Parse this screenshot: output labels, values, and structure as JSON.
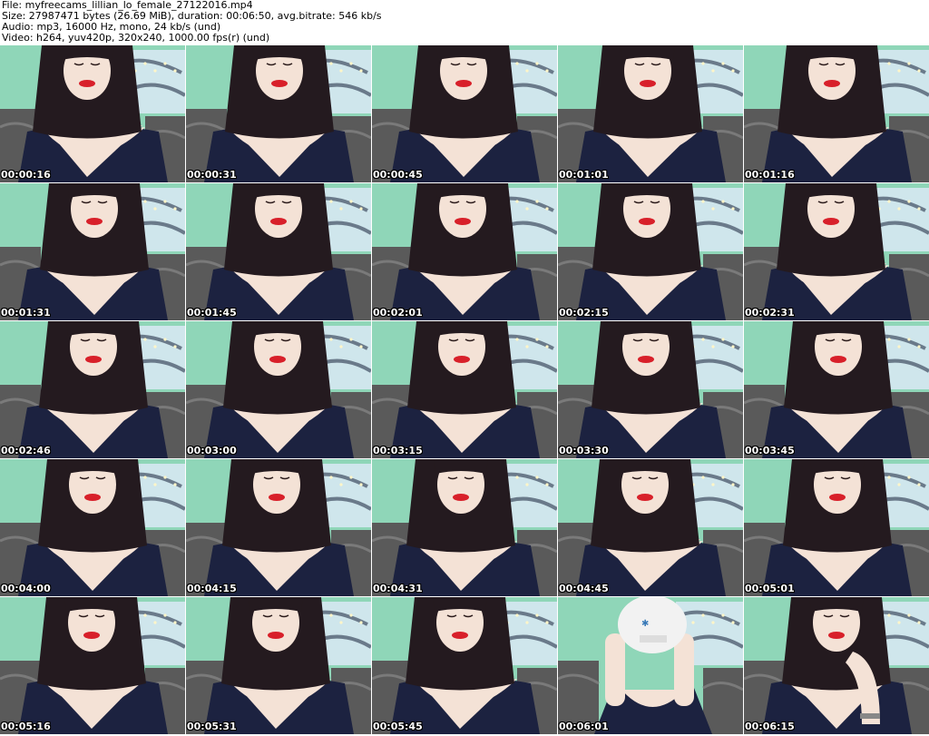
{
  "header": {
    "file_line": "File: myfreecams_lillian_lo_female_27122016.mp4",
    "size_line": "Size: 27987471 bytes (26.69 MiB), duration: 00:06:50, avg.bitrate: 546 kb/s",
    "audio_line": "Audio: mp3, 16000 Hz, mono, 24 kb/s (und)",
    "video_line": "Video: h264, yuv420p, 320x240, 1000.00 fps(r) (und)"
  },
  "colors": {
    "wall": "#8fd6b8",
    "sofa": "#5a5a5a",
    "hair": "#241a1f",
    "skin": "#f4e2d6",
    "dress": "#1c2240",
    "lips": "#d8202a",
    "mug": "#f2f2f2"
  },
  "thumbnails": [
    {
      "time": "00:00:16",
      "variant": "normal"
    },
    {
      "time": "00:00:31",
      "variant": "normal"
    },
    {
      "time": "00:00:45",
      "variant": "normal"
    },
    {
      "time": "00:01:01",
      "variant": "normal"
    },
    {
      "time": "00:01:16",
      "variant": "normal"
    },
    {
      "time": "00:01:31",
      "variant": "normal"
    },
    {
      "time": "00:01:45",
      "variant": "normal"
    },
    {
      "time": "00:02:01",
      "variant": "normal"
    },
    {
      "time": "00:02:15",
      "variant": "normal"
    },
    {
      "time": "00:02:31",
      "variant": "normal"
    },
    {
      "time": "00:02:46",
      "variant": "normal"
    },
    {
      "time": "00:03:00",
      "variant": "normal"
    },
    {
      "time": "00:03:15",
      "variant": "normal"
    },
    {
      "time": "00:03:30",
      "variant": "normal"
    },
    {
      "time": "00:03:45",
      "variant": "normal"
    },
    {
      "time": "00:04:00",
      "variant": "normal"
    },
    {
      "time": "00:04:15",
      "variant": "normal"
    },
    {
      "time": "00:04:31",
      "variant": "normal"
    },
    {
      "time": "00:04:45",
      "variant": "normal"
    },
    {
      "time": "00:05:01",
      "variant": "normal"
    },
    {
      "time": "00:05:16",
      "variant": "normal"
    },
    {
      "time": "00:05:31",
      "variant": "normal"
    },
    {
      "time": "00:05:45",
      "variant": "normal"
    },
    {
      "time": "00:06:01",
      "variant": "mug"
    },
    {
      "time": "00:06:15",
      "variant": "hand"
    }
  ]
}
